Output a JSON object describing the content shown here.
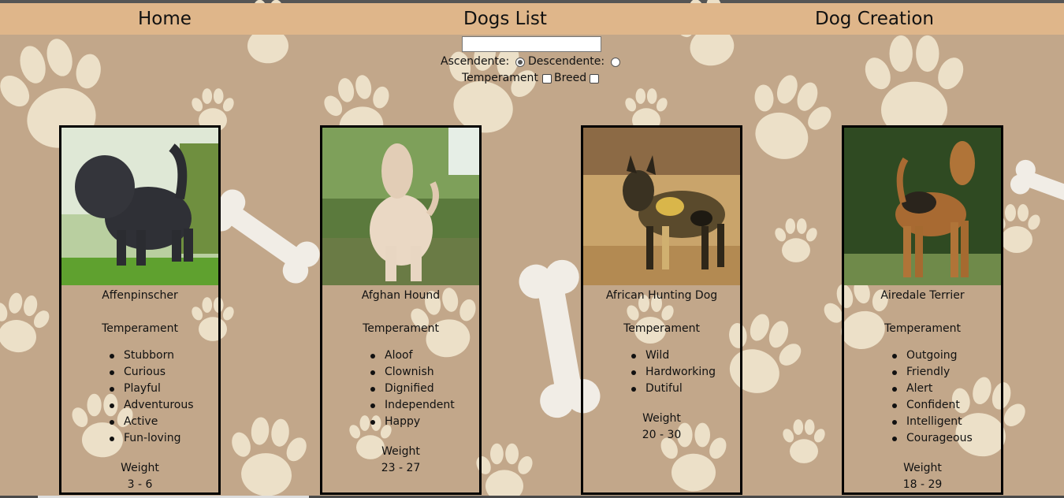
{
  "nav": {
    "home": "Home",
    "list": "Dogs List",
    "create": "Dog Creation"
  },
  "search": {
    "value": "",
    "placeholder": ""
  },
  "sort": {
    "asc_label": "Ascendente:",
    "desc_label": "Descendente:",
    "selected": "asc"
  },
  "filter": {
    "temperament_label": "Temperament",
    "breed_label": "Breed"
  },
  "colors": {
    "background": "#c2a78a",
    "navbar": "#dfb68a",
    "paw": "#ece0c8",
    "bone": "#f1ede6"
  },
  "cards": [
    {
      "name": "Affenpinscher",
      "temperament_title": "Temperament",
      "temperaments": [
        "Stubborn",
        "Curious",
        "Playful",
        "Adventurous",
        "Active",
        "Fun-loving"
      ],
      "weight_title": "Weight",
      "weight": "3 - 6"
    },
    {
      "name": "Afghan Hound",
      "temperament_title": "Temperament",
      "temperaments": [
        "Aloof",
        "Clownish",
        "Dignified",
        "Independent",
        "Happy"
      ],
      "weight_title": "Weight",
      "weight": "23 - 27"
    },
    {
      "name": "African Hunting Dog",
      "temperament_title": "Temperament",
      "temperaments": [
        "Wild",
        "Hardworking",
        "Dutiful"
      ],
      "weight_title": "Weight",
      "weight": "20 - 30"
    },
    {
      "name": "Airedale Terrier",
      "temperament_title": "Temperament",
      "temperaments": [
        "Outgoing",
        "Friendly",
        "Alert",
        "Confident",
        "Intelligent",
        "Courageous"
      ],
      "weight_title": "Weight",
      "weight": "18 - 29"
    }
  ]
}
